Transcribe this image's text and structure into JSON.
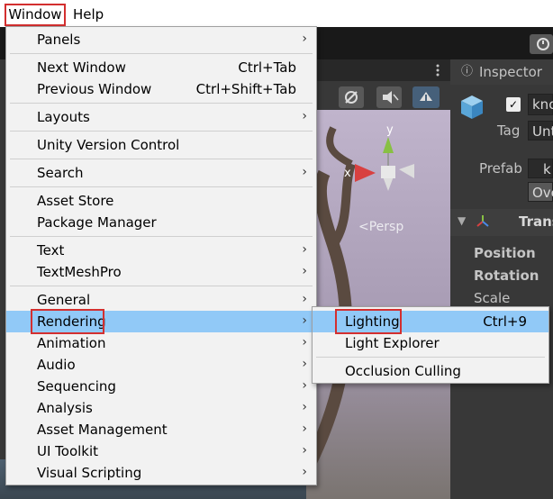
{
  "menubar": {
    "window": "Window",
    "help": "Help"
  },
  "window_menu": {
    "panels": "Panels",
    "next_window": "Next Window",
    "next_window_sc": "Ctrl+Tab",
    "prev_window": "Previous Window",
    "prev_window_sc": "Ctrl+Shift+Tab",
    "layouts": "Layouts",
    "uvc": "Unity Version Control",
    "search": "Search",
    "asset_store": "Asset Store",
    "package_manager": "Package Manager",
    "text": "Text",
    "textmeshpro": "TextMeshPro",
    "general": "General",
    "rendering": "Rendering",
    "animation": "Animation",
    "audio": "Audio",
    "sequencing": "Sequencing",
    "analysis": "Analysis",
    "asset_management": "Asset Management",
    "ui_toolkit": "UI Toolkit",
    "visual_scripting": "Visual Scripting",
    "arrow": "›"
  },
  "rendering_submenu": {
    "lighting": "Lighting",
    "lighting_sc": "Ctrl+9",
    "light_explorer": "Light Explorer",
    "occlusion_culling": "Occlusion Culling"
  },
  "scene": {
    "persp_label": "<Persp",
    "axis_y": "y",
    "axis_x": "x"
  },
  "inspector": {
    "tab": "Inspector",
    "name": "kno",
    "tag_label": "Tag",
    "tag_value": "Unt",
    "prefab_label": "Prefab",
    "prefab_value": "k",
    "override_btn": "Ove",
    "transform": "Trans",
    "position": "Position",
    "rotation": "Rotation",
    "scale": "Scale"
  },
  "colors": {
    "highlight": "#91c9f7",
    "callout": "#d32f2f",
    "menu_bg": "#f2f2f2"
  }
}
